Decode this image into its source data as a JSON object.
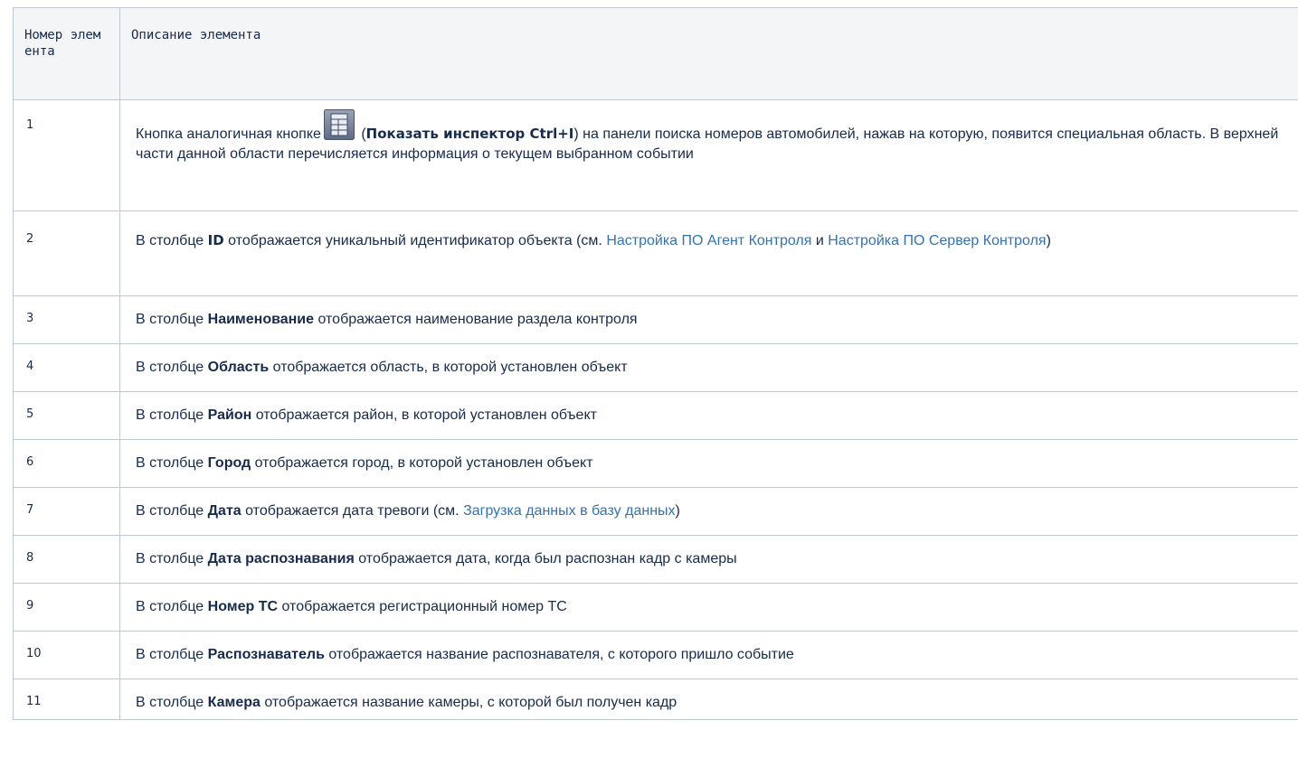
{
  "header": {
    "col_number": "Номер элемента",
    "col_description": "Описание элемента"
  },
  "rows": [
    {
      "number": "1",
      "prefix": "Кнопка аналогичная кнопке",
      "icon": "inspector-grid-icon",
      "paren_open": " (",
      "bold": "Показать инспектор Ctrl+I",
      "suffix": ") на панели поиска номеров автомобилей, нажав на которую, появится специальная область. В верхней части данной области перечисляется информация о текущем выбранном событии"
    },
    {
      "number": "2",
      "prefix": "В столбце ",
      "bold": "ID",
      "middle": " отображается уникальный идентификатор объекта (см. ",
      "link1": "Настройка ПО Агент Контроля",
      "and": " и ",
      "link2": "Настройка ПО Сервер Контроля",
      "suffix": ")"
    },
    {
      "number": "3",
      "prefix": "В столбце ",
      "bold": "Наименование",
      "suffix": " отображается наименование раздела контроля"
    },
    {
      "number": "4",
      "prefix": "В столбце ",
      "bold": "Область",
      "suffix": " отображается область, в которой установлен объект"
    },
    {
      "number": "5",
      "prefix": "В столбце ",
      "bold": "Район",
      "suffix": " отображается район, в которой установлен объект"
    },
    {
      "number": "6",
      "prefix": "В столбце ",
      "bold": "Город",
      "suffix": " отображается город, в которой установлен объект"
    },
    {
      "number": "7",
      "prefix": "В столбце ",
      "bold": "Дата",
      "middle": " отображается дата тревоги (см. ",
      "link1": "Загрузка данных в базу данных",
      "suffix": ")"
    },
    {
      "number": "8",
      "prefix": "В столбце ",
      "bold": "Дата распознавания",
      "suffix": " отображается дата, когда был распознан кадр с камеры"
    },
    {
      "number": "9",
      "prefix": "В столбце ",
      "bold": "Номер ТС",
      "suffix": " отображается регистрационный номер ТС"
    },
    {
      "number": "10",
      "prefix": "В столбце ",
      "bold": "Распознаватель",
      "suffix": " отображается название распознавателя, с которого пришло событие"
    },
    {
      "number": "11",
      "prefix": "В столбце ",
      "bold": "Камера",
      "suffix": " отображается название камеры, с которой был получен кадр"
    }
  ],
  "colors": {
    "text": "#172b4d",
    "link": "#3572b0",
    "header_bg": "#f4f5f7",
    "border": "#c1c7d0"
  }
}
